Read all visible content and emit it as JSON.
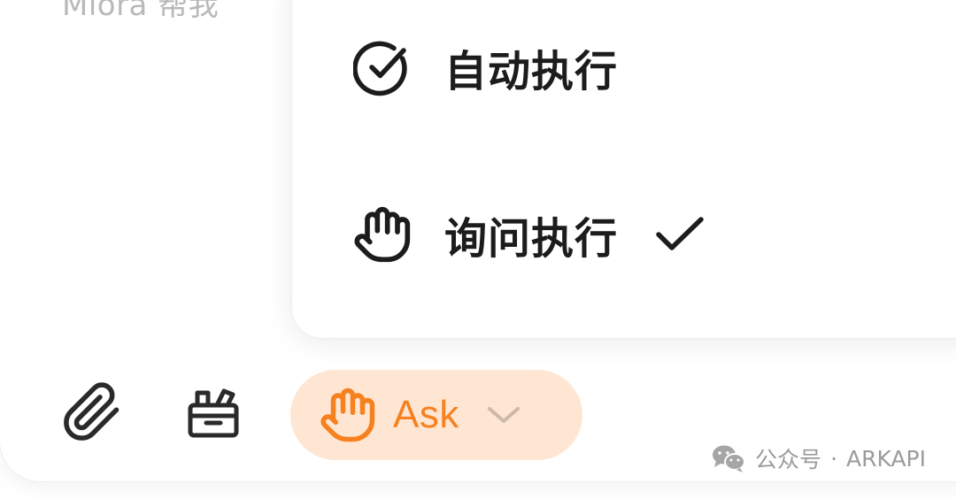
{
  "composer": {
    "placeholder": "Mlora 帮我"
  },
  "mode_menu": {
    "items": [
      {
        "label": "自动执行",
        "icon": "check-circle-icon",
        "selected": false
      },
      {
        "label": "询问执行",
        "icon": "hand-icon",
        "selected": true
      }
    ]
  },
  "toolbar": {
    "attach_icon": "paperclip-icon",
    "box_icon": "toolbox-icon",
    "mode_button": {
      "label": "Ask",
      "icon": "hand-icon",
      "chevron": "chevron-down-icon"
    }
  },
  "watermark": {
    "prefix": "公众号",
    "separator": "·",
    "name": "ARKAPI"
  },
  "colors": {
    "accent": "#f7801f",
    "accent_bg": "#ffe6d3",
    "text": "#1c1c1c",
    "muted": "#9b9b9b"
  }
}
